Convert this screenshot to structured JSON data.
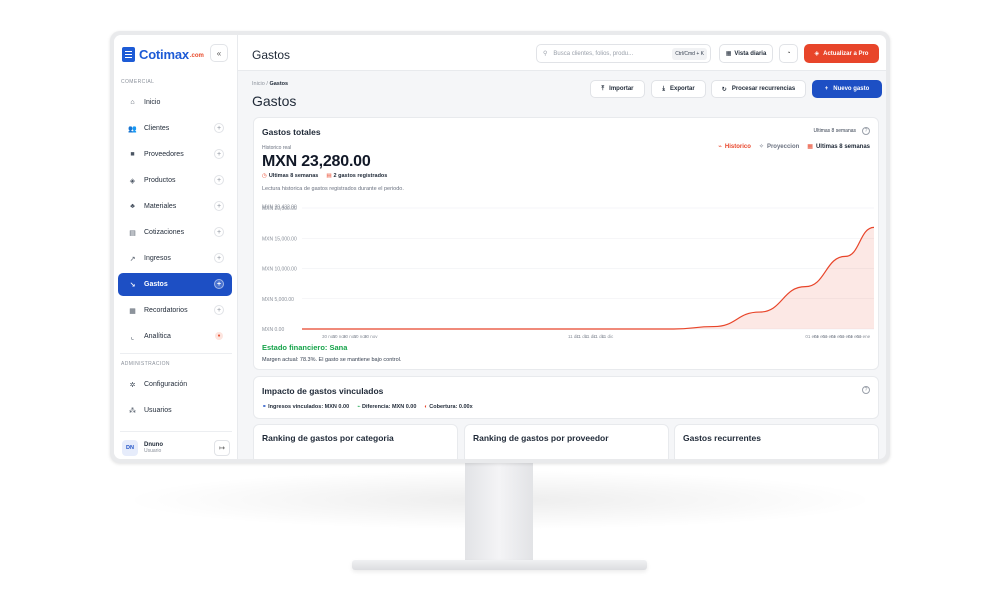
{
  "brand": {
    "name": "Cotimax",
    "suffix": ".com"
  },
  "sidebar": {
    "collapse_glyph": "«",
    "section_commercial": "COMERCIAL",
    "section_admin": "ADMINISTRACION",
    "items": [
      {
        "label": "Inicio",
        "icon": "home-icon",
        "glyph": "⌂"
      },
      {
        "label": "Clientes",
        "icon": "users-icon",
        "glyph": "👥"
      },
      {
        "label": "Proveedores",
        "icon": "truck-icon",
        "glyph": "🚚"
      },
      {
        "label": "Productos",
        "icon": "box-icon",
        "glyph": "◈"
      },
      {
        "label": "Materiales",
        "icon": "materials-icon",
        "glyph": "♣"
      },
      {
        "label": "Cotizaciones",
        "icon": "document-icon",
        "glyph": "▤"
      },
      {
        "label": "Ingresos",
        "icon": "trend-up-icon",
        "glyph": "↗"
      },
      {
        "label": "Gastos",
        "icon": "trend-down-icon",
        "glyph": "↘"
      },
      {
        "label": "Recordatorios",
        "icon": "calendar-icon",
        "glyph": "▦"
      },
      {
        "label": "Analítica",
        "icon": "chart-icon",
        "glyph": "⌞"
      }
    ],
    "admin_items": [
      {
        "label": "Configuración",
        "icon": "gear-icon",
        "glyph": "✲"
      },
      {
        "label": "Usuarios",
        "icon": "team-icon",
        "glyph": "⁂"
      }
    ],
    "user": {
      "initials": "DN",
      "name": "Dnuno",
      "role": "Usuario",
      "logout_glyph": "↦"
    }
  },
  "topbar": {
    "title": "Gastos",
    "search_placeholder": "Busca clientes, folios, produ...",
    "search_shortcut": "Ctrl/Cmd + K",
    "daily_view": "Vista diaria",
    "upgrade": "Actualizar a Pro"
  },
  "header": {
    "breadcrumb_root": "Inicio /",
    "breadcrumb_current": "Gastos",
    "title": "Gastos",
    "import": "Importar",
    "export": "Exportar",
    "recurring": "Procesar recurrencias",
    "new_expense": "Nuevo gasto"
  },
  "summary": {
    "title": "Gastos totales",
    "range_label": "Ultimas 8 semanas",
    "subtitle": "Historico real",
    "total": "MXN 23,280.00",
    "period": "Ultimas 8 semanas",
    "count": "2 gastos registrados",
    "description": "Lectura historica de gastos registrados durante el periodo.",
    "legend_history": "Historico",
    "legend_projection": "Proyeccion",
    "legend_range": "Ultimas 8 semanas",
    "status": "Estado financiero: Sana",
    "margin_note": "Margen actual: 78.3%. El gasto se mantiene bajo control."
  },
  "chart_data": {
    "type": "area",
    "y_ticks": [
      "MXN 0.00",
      "MXN 5,000.00",
      "MXN 10,000.00",
      "MXN 15,000.00",
      "MXN 20,000.00"
    ],
    "y_overlap_tick": "MXN 20,432.00",
    "ylim": [
      0,
      20000
    ],
    "x_tick_groups": [
      [
        "30 nov",
        "30 nov",
        "30 nov",
        "30 nov",
        "30 nov"
      ],
      [
        "11 dic",
        "11 dic",
        "11 dic",
        "11 dic",
        "11 dic"
      ],
      [
        "01 ene",
        "01 ene",
        "01 ene",
        "01 ene",
        "01 ene",
        "01 ene",
        "01 ene"
      ]
    ],
    "series": [
      {
        "name": "Historico",
        "color": "#e8452a",
        "points": [
          [
            0,
            0
          ],
          [
            0.3,
            0
          ],
          [
            0.5,
            0
          ],
          [
            0.65,
            0
          ],
          [
            0.72,
            400
          ],
          [
            0.8,
            2800
          ],
          [
            0.88,
            7000
          ],
          [
            0.95,
            12000
          ],
          [
            1.0,
            16800
          ]
        ]
      }
    ]
  },
  "impact": {
    "title": "Impacto de gastos vinculados",
    "linked_income": "Ingresos vinculados: MXN 0.00",
    "difference": "Diferencia: MXN 0.00",
    "coverage": "Cobertura: 0.00x"
  },
  "bottom_cards": {
    "by_category": "Ranking de gastos por categoria",
    "by_provider": "Ranking de gastos por proveedor",
    "recurring": "Gastos recurrentes"
  },
  "colors": {
    "accent": "#1d4fc4",
    "danger": "#e8452a",
    "success": "#16a34a"
  }
}
